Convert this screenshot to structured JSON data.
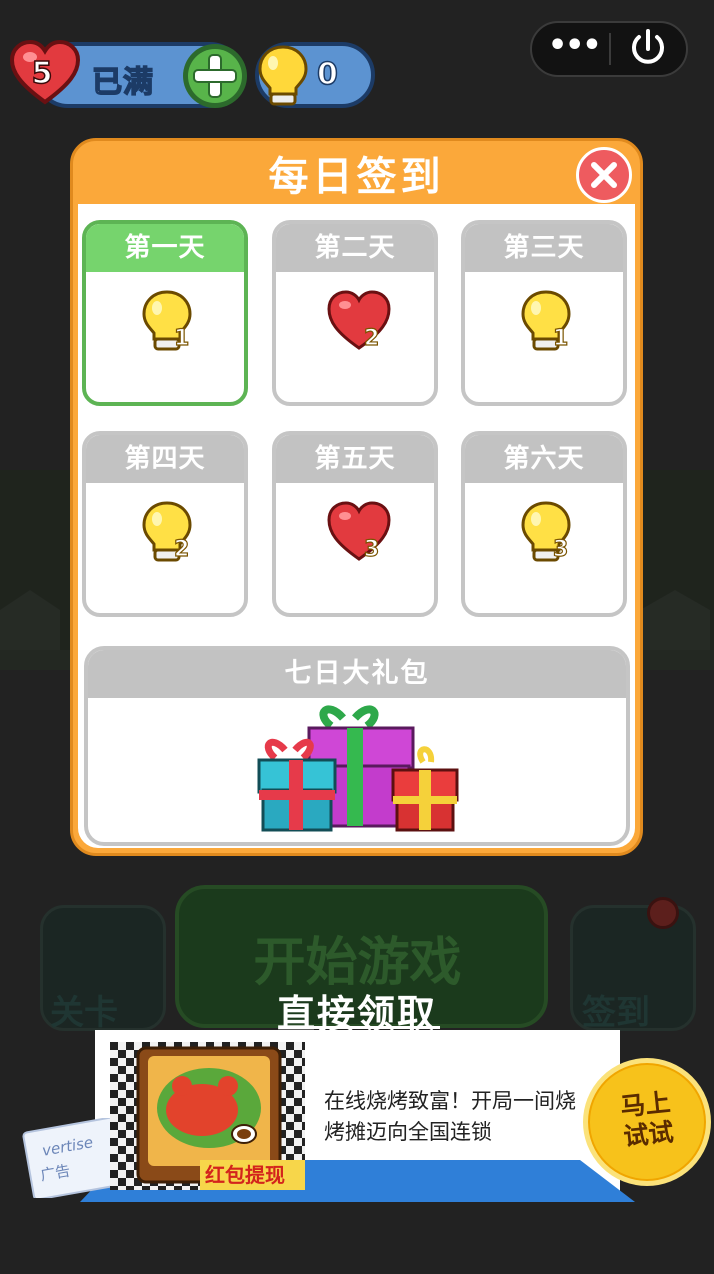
{
  "hud": {
    "hearts": "5",
    "hearts_status": "已满",
    "bulbs": "0"
  },
  "capsule": {
    "more": "•••"
  },
  "background": {
    "start_button": "开始游戏",
    "levels_label": "关卡",
    "checkin_label": "签到"
  },
  "dialog": {
    "title": "每日签到",
    "days": [
      {
        "label": "第一天",
        "reward": "bulb-icon",
        "count": "1",
        "state": "current"
      },
      {
        "label": "第二天",
        "reward": "heart-icon",
        "count": "2",
        "state": "pending"
      },
      {
        "label": "第三天",
        "reward": "bulb-icon",
        "count": "1",
        "state": "pending"
      },
      {
        "label": "第四天",
        "reward": "bulb-icon",
        "count": "2",
        "state": "pending"
      },
      {
        "label": "第五天",
        "reward": "heart-icon",
        "count": "3",
        "state": "pending"
      },
      {
        "label": "第六天",
        "reward": "bulb-icon",
        "count": "3",
        "state": "pending"
      }
    ],
    "big_pack": {
      "label": "七日大礼包"
    }
  },
  "claim": {
    "label": "直接领取"
  },
  "ad": {
    "image_caption": "红包提现",
    "text": "在线烧烤致富！开局一间烧烤摊迈向全国连锁",
    "stamp_text": "广告",
    "stamp_word": "vertise",
    "button_line1": "马上",
    "button_line2": "试试"
  },
  "colors": {
    "dialog_orange": "#fba83a",
    "active_green": "#76d46d",
    "inactive_grey": "#c2c2c2",
    "close_red": "#ee5b5f",
    "hud_blue": "#5c93d1",
    "try_yellow": "#f7c21b"
  }
}
